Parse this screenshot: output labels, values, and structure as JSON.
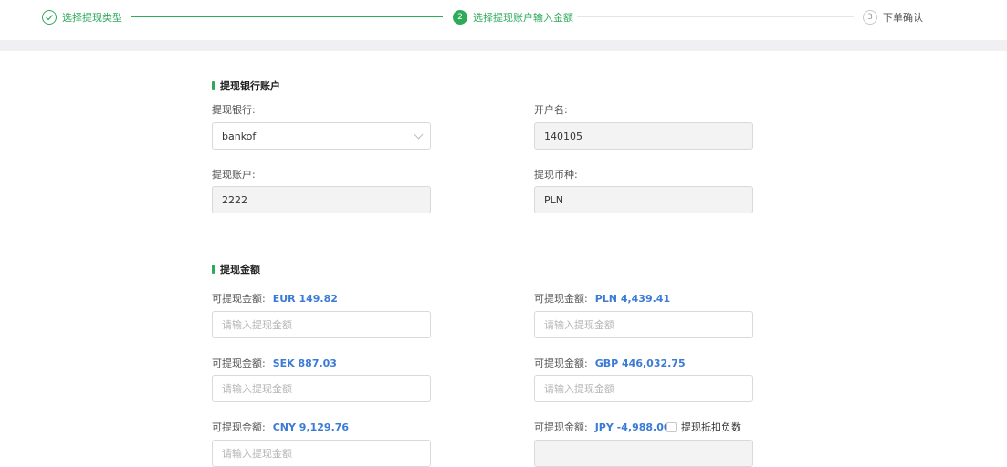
{
  "stepper": {
    "steps": [
      {
        "label": "选择提现类型",
        "state": "done",
        "icon": "check-icon"
      },
      {
        "label": "选择提现账户输入金额",
        "state": "active",
        "number": "2"
      },
      {
        "label": "下单确认",
        "state": "wait",
        "number": "3"
      }
    ],
    "colors": {
      "active": "#2eaa5b",
      "inactive": "#c8c8c8"
    }
  },
  "bank_section": {
    "title": "提现银行账户",
    "bank_label": "提现银行:",
    "bank_value": "bankof",
    "holder_label": "开户名:",
    "holder_value": "140105",
    "account_label": "提现账户:",
    "account_value": "2222",
    "currency_label": "提现币种:",
    "currency_value": "PLN"
  },
  "amount_section": {
    "title": "提现金额",
    "available_label": "可提现金额:",
    "placeholder": "请输入提现金额",
    "balances": [
      {
        "currency_amount": "EUR 149.82"
      },
      {
        "currency_amount": "PLN 4,439.41"
      },
      {
        "currency_amount": "SEK 887.03"
      },
      {
        "currency_amount": "GBP 446,032.75"
      },
      {
        "currency_amount": "CNY 9,129.76"
      },
      {
        "currency_amount": "JPY -4,988.00"
      }
    ],
    "deduct_negative_label": "提现抵扣负数",
    "amount_color": "#3b7bd6"
  }
}
